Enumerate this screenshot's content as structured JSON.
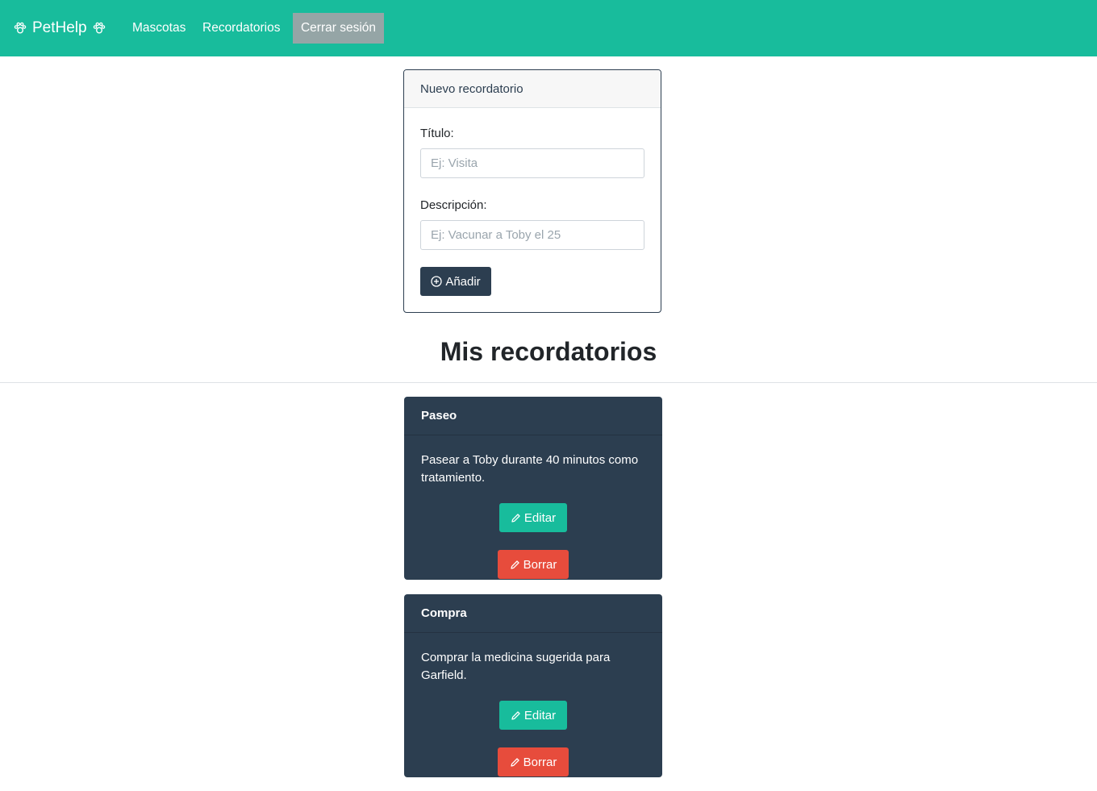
{
  "navbar": {
    "brand": "PetHelp",
    "brand_icon": "paw-icon",
    "links": [
      "Mascotas",
      "Recordatorios"
    ],
    "logout": "Cerrar sesión",
    "color": "#18bc9c",
    "logout_color": "#95a5a6"
  },
  "form": {
    "header": "Nuevo recordatorio",
    "title_label": "Título:",
    "title_placeholder": "Ej: Visita",
    "title_value": "",
    "description_label": "Descripción:",
    "description_placeholder": "Ej: Vacunar a Toby el 25",
    "description_value": "",
    "add_button": "Añadir",
    "add_icon": "plus-circle-icon"
  },
  "section_title": "Mis recordatorios",
  "reminders": [
    {
      "title": "Paseo",
      "description": "Pasear a Toby durante 40 minutos como tratamiento.",
      "edit_label": "Editar",
      "delete_label": "Borrar"
    },
    {
      "title": "Compra",
      "description": "Comprar la medicina sugerida para Garfield.",
      "edit_label": "Editar",
      "delete_label": "Borrar"
    }
  ],
  "colors": {
    "primary": "#2c3e50",
    "success": "#18bc9c",
    "danger": "#e74c3c"
  }
}
